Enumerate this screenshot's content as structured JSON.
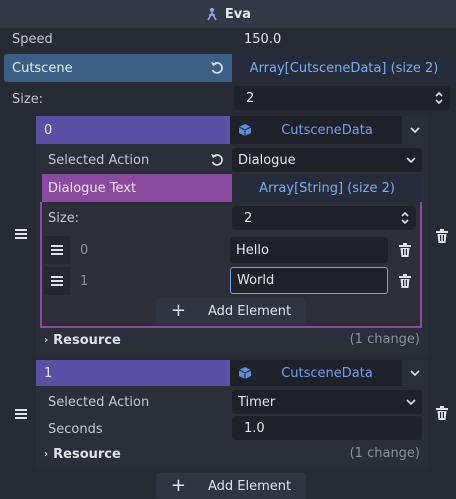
{
  "header": {
    "title": "Eva",
    "icon": "node-icon"
  },
  "speed": {
    "label": "Speed",
    "value": "150.0"
  },
  "cutscene": {
    "label": "Cutscene",
    "array_label": "Array[CutsceneData] (size 2)",
    "size_label": "Size:",
    "size_value": "2",
    "add_label": "Add Element",
    "items": [
      {
        "index": "0",
        "resource_type": "CutsceneData",
        "selected_action_label": "Selected Action",
        "selected_action_value": "Dialogue",
        "dialogue_text_label": "Dialogue Text",
        "dialogue_array_label": "Array[String] (size 2)",
        "inner_size_label": "Size:",
        "inner_size_value": "2",
        "strings": [
          {
            "index": "0",
            "value": "Hello"
          },
          {
            "index": "1",
            "value": "World"
          }
        ],
        "inner_add_label": "Add Element",
        "resource_label": "Resource",
        "resource_changes": "(1 change)"
      },
      {
        "index": "1",
        "resource_type": "CutsceneData",
        "selected_action_label": "Selected Action",
        "selected_action_value": "Timer",
        "seconds_label": "Seconds",
        "seconds_value": "1.0",
        "resource_label": "Resource",
        "resource_changes": "(1 change)"
      }
    ]
  },
  "colors": {
    "background": "#272b34",
    "blue_bar": "#3b5f85",
    "purple_bar": "#5b4fa6",
    "magenta_bar": "#8a4aa0",
    "accent_link": "#79aef2"
  }
}
